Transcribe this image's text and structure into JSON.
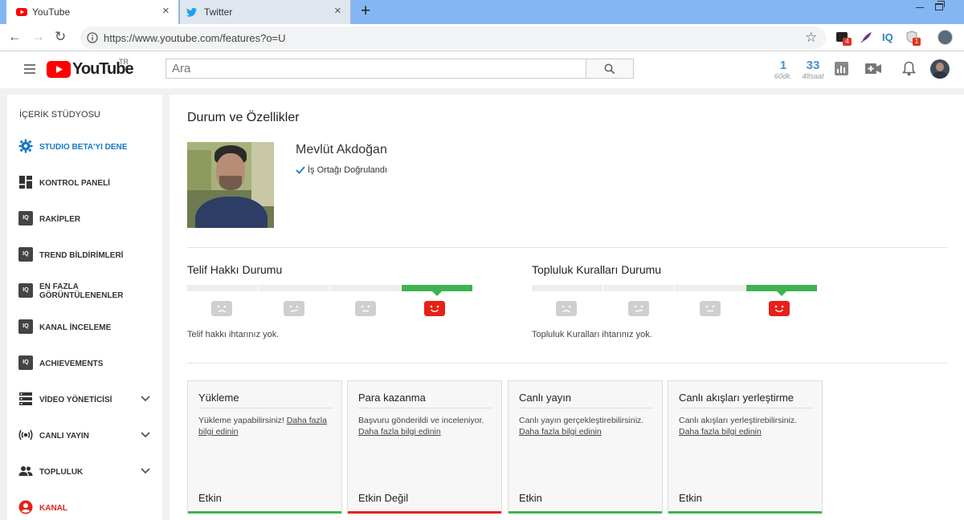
{
  "browser": {
    "tabs": [
      {
        "title": "YouTube",
        "icon": "youtube-icon"
      },
      {
        "title": "Twitter",
        "icon": "twitter-bird-icon"
      }
    ],
    "new_tab_label": "+",
    "close_glyph": "×",
    "back_glyph": "←",
    "forward_glyph": "→",
    "reload_glyph": "↻",
    "url": "https://www.youtube.com/features?o=U",
    "star_glyph": "☆",
    "extensions": {
      "badge_1": "4",
      "iq_label": "IQ",
      "badge_2": "1"
    }
  },
  "header": {
    "logo_text": "YouTube",
    "region": "TR",
    "search_placeholder": "Ara",
    "stats": [
      {
        "value": "1",
        "label": "60dk."
      },
      {
        "value": "33",
        "label": "48saat"
      }
    ]
  },
  "sidebar": {
    "title": "İÇERİK STÜDYOSU",
    "items": [
      {
        "label": "STUDIO BETA'YI DENE",
        "icon": "gear-icon"
      },
      {
        "label": "KONTROL PANELİ",
        "icon": "dashboard-icon"
      },
      {
        "label": "RAKİPLER",
        "icon": "vidiq-icon"
      },
      {
        "label": "TREND BİLDİRİMLERİ",
        "icon": "vidiq-icon"
      },
      {
        "label": "EN FAZLA GÖRÜNTÜLENENLER",
        "icon": "vidiq-icon"
      },
      {
        "label": "KANAL İNCELEME",
        "icon": "vidiq-icon"
      },
      {
        "label": "ACHIEVEMENTS",
        "icon": "vidiq-icon"
      },
      {
        "label": "VİDEO YÖNETİCİSİ",
        "icon": "video-manager-icon"
      },
      {
        "label": "CANLI YAYIN",
        "icon": "live-broadcast-icon"
      },
      {
        "label": "TOPLULUK",
        "icon": "community-icon"
      },
      {
        "label": "KANAL",
        "icon": "channel-icon"
      }
    ]
  },
  "main": {
    "page_title": "Durum ve Özellikler",
    "profile": {
      "name": "Mevlüt Akdoğan",
      "verified_label": "İş Ortağı Doğrulandı"
    },
    "copyright": {
      "title": "Telif Hakkı Durumu",
      "message": "Telif hakkı ihtarınız yok."
    },
    "community": {
      "title": "Topluluk Kuralları Durumu",
      "message": "Topluluk Kuralları ihtarınız yok."
    },
    "features": [
      {
        "title": "Yükleme",
        "desc": "Yükleme yapabilirsiniz!",
        "link": "Daha fazla bilgi edinin",
        "status": "Etkin",
        "enabled": true
      },
      {
        "title": "Para kazanma",
        "desc": "Başvuru gönderildi ve inceleniyor.",
        "link": "Daha fazla bilgi edinin",
        "status": "Etkin Değil",
        "enabled": false
      },
      {
        "title": "Canlı yayın",
        "desc": "Canlı yayın gerçekleştirebilirsiniz.",
        "link": "Daha fazla bilgi edinin",
        "status": "Etkin",
        "enabled": true
      },
      {
        "title": "Canlı akışları yerleştirme",
        "desc": "Canlı akışları yerleştirebilirsiniz.",
        "link": "Daha fazla bilgi edinin",
        "status": "Etkin",
        "enabled": true
      }
    ]
  },
  "colors": {
    "youtube_red": "#ff0000",
    "enabled_green": "#3fb34f",
    "disabled_red": "#e62117",
    "link_blue": "#167ac6",
    "stat_blue": "#4a90d2"
  }
}
